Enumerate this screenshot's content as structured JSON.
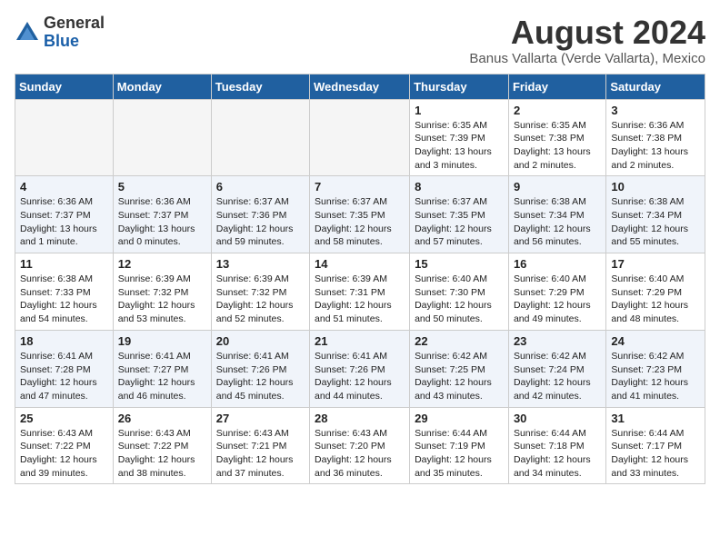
{
  "logo": {
    "general": "General",
    "blue": "Blue"
  },
  "title": "August 2024",
  "subtitle": "Banus Vallarta (Verde Vallarta), Mexico",
  "headers": [
    "Sunday",
    "Monday",
    "Tuesday",
    "Wednesday",
    "Thursday",
    "Friday",
    "Saturday"
  ],
  "weeks": [
    [
      {
        "day": "",
        "info": ""
      },
      {
        "day": "",
        "info": ""
      },
      {
        "day": "",
        "info": ""
      },
      {
        "day": "",
        "info": ""
      },
      {
        "day": "1",
        "info": "Sunrise: 6:35 AM\nSunset: 7:39 PM\nDaylight: 13 hours\nand 3 minutes."
      },
      {
        "day": "2",
        "info": "Sunrise: 6:35 AM\nSunset: 7:38 PM\nDaylight: 13 hours\nand 2 minutes."
      },
      {
        "day": "3",
        "info": "Sunrise: 6:36 AM\nSunset: 7:38 PM\nDaylight: 13 hours\nand 2 minutes."
      }
    ],
    [
      {
        "day": "4",
        "info": "Sunrise: 6:36 AM\nSunset: 7:37 PM\nDaylight: 13 hours\nand 1 minute."
      },
      {
        "day": "5",
        "info": "Sunrise: 6:36 AM\nSunset: 7:37 PM\nDaylight: 13 hours\nand 0 minutes."
      },
      {
        "day": "6",
        "info": "Sunrise: 6:37 AM\nSunset: 7:36 PM\nDaylight: 12 hours\nand 59 minutes."
      },
      {
        "day": "7",
        "info": "Sunrise: 6:37 AM\nSunset: 7:35 PM\nDaylight: 12 hours\nand 58 minutes."
      },
      {
        "day": "8",
        "info": "Sunrise: 6:37 AM\nSunset: 7:35 PM\nDaylight: 12 hours\nand 57 minutes."
      },
      {
        "day": "9",
        "info": "Sunrise: 6:38 AM\nSunset: 7:34 PM\nDaylight: 12 hours\nand 56 minutes."
      },
      {
        "day": "10",
        "info": "Sunrise: 6:38 AM\nSunset: 7:34 PM\nDaylight: 12 hours\nand 55 minutes."
      }
    ],
    [
      {
        "day": "11",
        "info": "Sunrise: 6:38 AM\nSunset: 7:33 PM\nDaylight: 12 hours\nand 54 minutes."
      },
      {
        "day": "12",
        "info": "Sunrise: 6:39 AM\nSunset: 7:32 PM\nDaylight: 12 hours\nand 53 minutes."
      },
      {
        "day": "13",
        "info": "Sunrise: 6:39 AM\nSunset: 7:32 PM\nDaylight: 12 hours\nand 52 minutes."
      },
      {
        "day": "14",
        "info": "Sunrise: 6:39 AM\nSunset: 7:31 PM\nDaylight: 12 hours\nand 51 minutes."
      },
      {
        "day": "15",
        "info": "Sunrise: 6:40 AM\nSunset: 7:30 PM\nDaylight: 12 hours\nand 50 minutes."
      },
      {
        "day": "16",
        "info": "Sunrise: 6:40 AM\nSunset: 7:29 PM\nDaylight: 12 hours\nand 49 minutes."
      },
      {
        "day": "17",
        "info": "Sunrise: 6:40 AM\nSunset: 7:29 PM\nDaylight: 12 hours\nand 48 minutes."
      }
    ],
    [
      {
        "day": "18",
        "info": "Sunrise: 6:41 AM\nSunset: 7:28 PM\nDaylight: 12 hours\nand 47 minutes."
      },
      {
        "day": "19",
        "info": "Sunrise: 6:41 AM\nSunset: 7:27 PM\nDaylight: 12 hours\nand 46 minutes."
      },
      {
        "day": "20",
        "info": "Sunrise: 6:41 AM\nSunset: 7:26 PM\nDaylight: 12 hours\nand 45 minutes."
      },
      {
        "day": "21",
        "info": "Sunrise: 6:41 AM\nSunset: 7:26 PM\nDaylight: 12 hours\nand 44 minutes."
      },
      {
        "day": "22",
        "info": "Sunrise: 6:42 AM\nSunset: 7:25 PM\nDaylight: 12 hours\nand 43 minutes."
      },
      {
        "day": "23",
        "info": "Sunrise: 6:42 AM\nSunset: 7:24 PM\nDaylight: 12 hours\nand 42 minutes."
      },
      {
        "day": "24",
        "info": "Sunrise: 6:42 AM\nSunset: 7:23 PM\nDaylight: 12 hours\nand 41 minutes."
      }
    ],
    [
      {
        "day": "25",
        "info": "Sunrise: 6:43 AM\nSunset: 7:22 PM\nDaylight: 12 hours\nand 39 minutes."
      },
      {
        "day": "26",
        "info": "Sunrise: 6:43 AM\nSunset: 7:22 PM\nDaylight: 12 hours\nand 38 minutes."
      },
      {
        "day": "27",
        "info": "Sunrise: 6:43 AM\nSunset: 7:21 PM\nDaylight: 12 hours\nand 37 minutes."
      },
      {
        "day": "28",
        "info": "Sunrise: 6:43 AM\nSunset: 7:20 PM\nDaylight: 12 hours\nand 36 minutes."
      },
      {
        "day": "29",
        "info": "Sunrise: 6:44 AM\nSunset: 7:19 PM\nDaylight: 12 hours\nand 35 minutes."
      },
      {
        "day": "30",
        "info": "Sunrise: 6:44 AM\nSunset: 7:18 PM\nDaylight: 12 hours\nand 34 minutes."
      },
      {
        "day": "31",
        "info": "Sunrise: 6:44 AM\nSunset: 7:17 PM\nDaylight: 12 hours\nand 33 minutes."
      }
    ]
  ]
}
